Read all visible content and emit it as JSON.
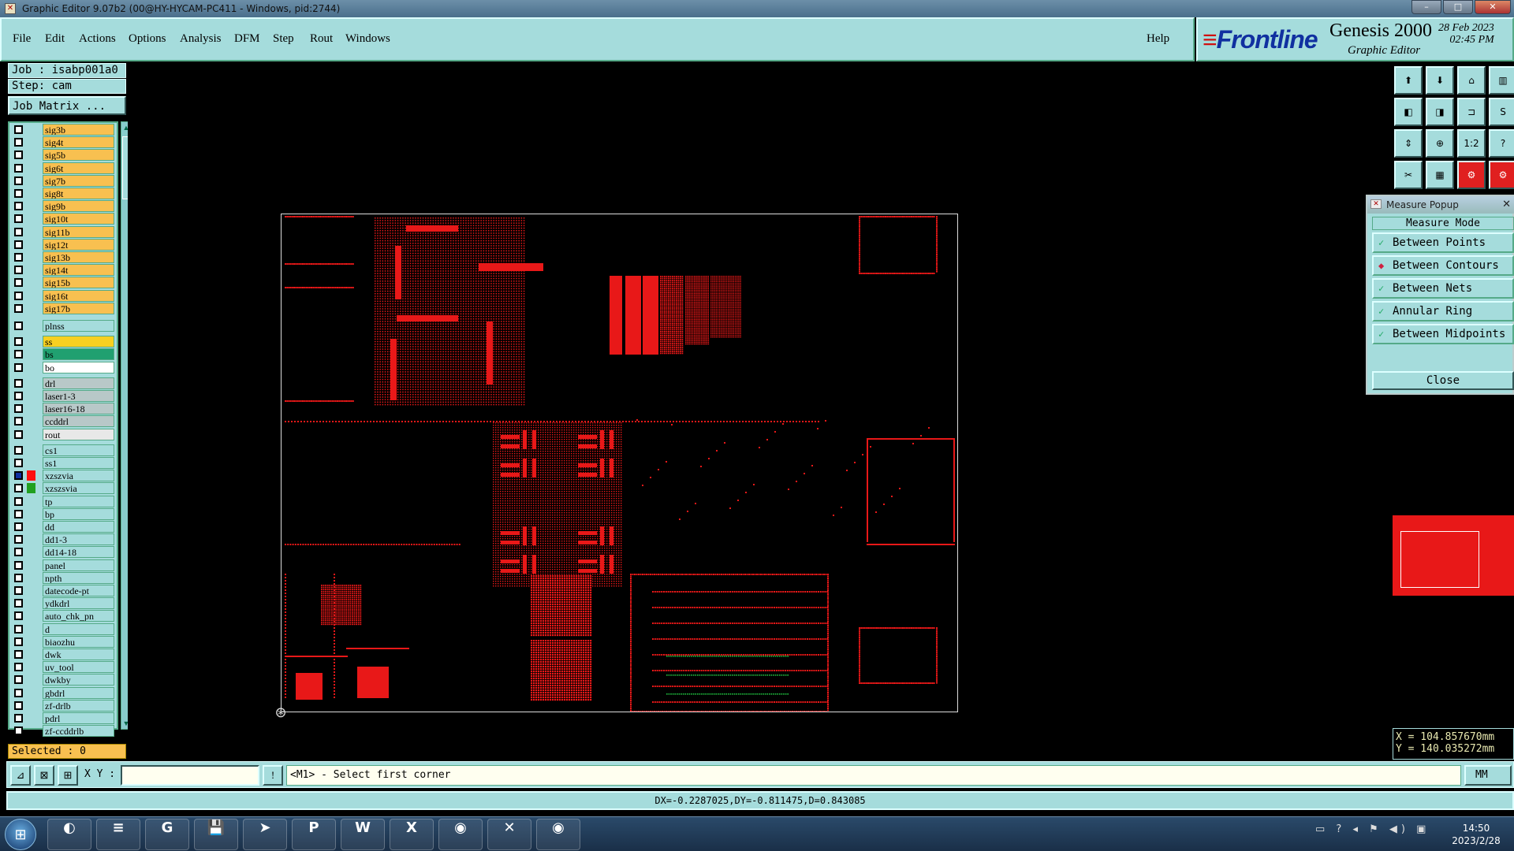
{
  "window": {
    "title": "Graphic Editor 9.07b2 (00@HY-HYCAM-PC411 - Windows, pid:2744)",
    "controls": [
      "–",
      "□",
      "✕"
    ]
  },
  "menu": {
    "items": [
      "File",
      "Edit",
      "Actions",
      "Options",
      "Analysis",
      "DFM",
      "Step",
      "Rout",
      "Windows"
    ],
    "help": "Help"
  },
  "brand": {
    "logo": "Frontline",
    "product": "Genesis 2000",
    "subtitle": "Graphic Editor",
    "date": "28 Feb 2023",
    "time": "02:45 PM"
  },
  "job": {
    "job_label": "Job : isabp001a0",
    "step_label": "Step: cam",
    "matrix_button": "Job Matrix ..."
  },
  "layers": [
    {
      "name": "sig3b",
      "color": "#f8c050"
    },
    {
      "name": "sig4t",
      "color": "#f8c050"
    },
    {
      "name": "sig5b",
      "color": "#f8c050"
    },
    {
      "name": "sig6t",
      "color": "#f8c050"
    },
    {
      "name": "sig7b",
      "color": "#f8c050"
    },
    {
      "name": "sig8t",
      "color": "#f8c050"
    },
    {
      "name": "sig9b",
      "color": "#f8c050"
    },
    {
      "name": "sig10t",
      "color": "#f8c050"
    },
    {
      "name": "sig11b",
      "color": "#f8c050"
    },
    {
      "name": "sig12t",
      "color": "#f8c050"
    },
    {
      "name": "sig13b",
      "color": "#f8c050"
    },
    {
      "name": "sig14t",
      "color": "#f8c050"
    },
    {
      "name": "sig15b",
      "color": "#f8c050"
    },
    {
      "name": "sig16t",
      "color": "#f8c050"
    },
    {
      "name": "sig17b",
      "color": "#f8c050"
    },
    {
      "name": "plnss",
      "color": "#a5dcdc"
    },
    {
      "name": "ss",
      "color": "#f8d020"
    },
    {
      "name": "bs",
      "color": "#20a070"
    },
    {
      "name": "bo",
      "color": "#ffffff"
    },
    {
      "name": "drl",
      "color": "#b8c8c8"
    },
    {
      "name": "laser1-3",
      "color": "#b8c8c8"
    },
    {
      "name": "laser16-18",
      "color": "#b8c8c8"
    },
    {
      "name": "ccddrl",
      "color": "#b8c8c8"
    },
    {
      "name": "rout",
      "color": "#e8e8e8"
    },
    {
      "name": "cs1",
      "color": "#a5dcdc"
    },
    {
      "name": "ss1",
      "color": "#a5dcdc"
    },
    {
      "name": "xzszvia",
      "color": "#a5dcdc",
      "swatch": "#ff1010",
      "active": true
    },
    {
      "name": "xzszsvia",
      "color": "#a5dcdc",
      "swatch": "#20a020"
    },
    {
      "name": "tp",
      "color": "#a5dcdc"
    },
    {
      "name": "bp",
      "color": "#a5dcdc"
    },
    {
      "name": "dd",
      "color": "#a5dcdc"
    },
    {
      "name": "dd1-3",
      "color": "#a5dcdc"
    },
    {
      "name": "dd14-18",
      "color": "#a5dcdc"
    },
    {
      "name": "panel",
      "color": "#a5dcdc"
    },
    {
      "name": "npth",
      "color": "#a5dcdc"
    },
    {
      "name": "datecode-pt",
      "color": "#a5dcdc"
    },
    {
      "name": "ydkdrl",
      "color": "#a5dcdc"
    },
    {
      "name": "auto_chk_pn",
      "color": "#a5dcdc"
    },
    {
      "name": "d",
      "color": "#a5dcdc"
    },
    {
      "name": "biaozhu",
      "color": "#a5dcdc"
    },
    {
      "name": "dwk",
      "color": "#a5dcdc"
    },
    {
      "name": "uv_tool",
      "color": "#a5dcdc"
    },
    {
      "name": "dwkby",
      "color": "#a5dcdc"
    },
    {
      "name": "gbdrl",
      "color": "#a5dcdc"
    },
    {
      "name": "zf-drlb",
      "color": "#a5dcdc"
    },
    {
      "name": "pdrl",
      "color": "#a5dcdc"
    },
    {
      "name": "zf-ccddrlb",
      "color": "#a5dcdc"
    }
  ],
  "selected_label": "Selected : 0",
  "toolbox": {
    "buttons": [
      "⬆",
      "⬇",
      "⌂",
      "▥",
      "◧",
      "◨",
      "⊐",
      "S",
      "⇕",
      "⊕",
      "1:2",
      "?",
      "✂",
      "▦",
      "⚙",
      "⚙"
    ]
  },
  "measure": {
    "title": "Measure Popup",
    "mode_label": "Measure Mode",
    "options": [
      {
        "label": "Between Points",
        "selected": false
      },
      {
        "label": "Between Contours",
        "selected": true
      },
      {
        "label": "Between Nets",
        "selected": false
      },
      {
        "label": "Annular Ring",
        "selected": false
      },
      {
        "label": "Between Midpoints",
        "selected": false
      }
    ],
    "close": "Close"
  },
  "coords": {
    "x": "X = 104.857670mm",
    "y": "Y = 140.035272mm"
  },
  "command": {
    "xy_label": "X Y :",
    "xy_value": "",
    "message": "<M1> - Select first corner",
    "unit": "MM"
  },
  "status": {
    "text": "DX=-0.2287025,DY=-0.811475,D=0.843085"
  },
  "taskbar": {
    "apps": [
      "◐",
      "≡",
      "G",
      "💾",
      "➤",
      "P",
      "W",
      "X",
      "◉",
      "✕",
      "◉"
    ],
    "tray": "▭ ? ◂ ⚑ ◀) ▣",
    "time": "14:50",
    "date": "2023/2/28"
  },
  "colors": {
    "panel": "#a5dcdc",
    "feature": "#e81818",
    "accent_green": "#20c040"
  }
}
